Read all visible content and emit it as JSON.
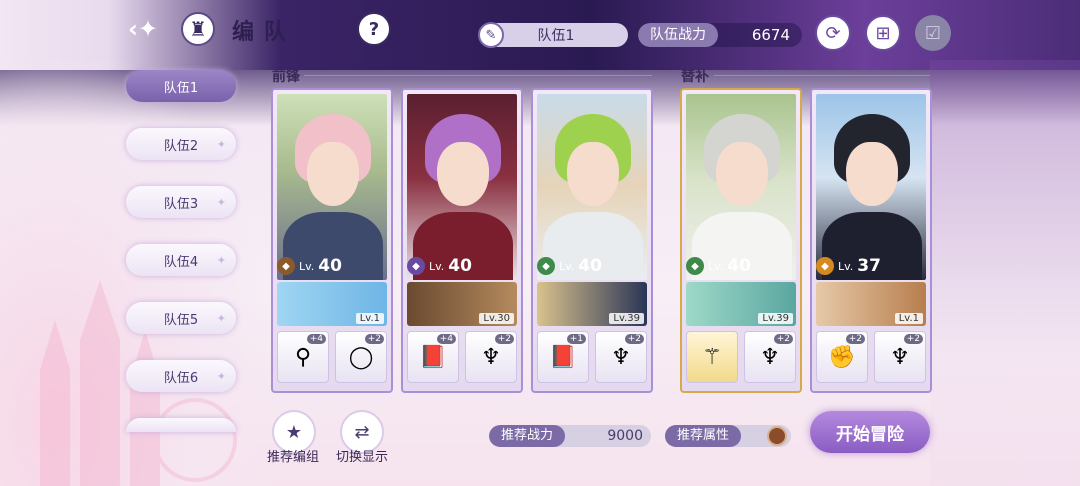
{
  "header": {
    "title": "编队",
    "current_team": "队伍1",
    "power_label": "队伍战力",
    "power_value": "6674"
  },
  "sidebar": {
    "teams": [
      "队伍1",
      "队伍2",
      "队伍3",
      "队伍4",
      "队伍5",
      "队伍6"
    ]
  },
  "sections": {
    "front": "前锋",
    "sub": "替补"
  },
  "cards": [
    {
      "level": "40",
      "element": "earth",
      "sub_level": "Lv.1",
      "equip": [
        {
          "icon": "staff-icon",
          "plus": "+4"
        },
        {
          "icon": "ring-icon",
          "plus": "+2"
        }
      ]
    },
    {
      "level": "40",
      "element": "arcane",
      "sub_level": "Lv.30",
      "equip": [
        {
          "icon": "book-icon",
          "plus": "+4"
        },
        {
          "icon": "earring-icon",
          "plus": "+2"
        }
      ]
    },
    {
      "level": "40",
      "element": "nature",
      "sub_level": "Lv.39",
      "equip": [
        {
          "icon": "book-icon",
          "plus": "+1"
        },
        {
          "icon": "earring-icon",
          "plus": "+2"
        }
      ]
    },
    {
      "level": "40",
      "element": "nature",
      "sub_level": "Lv.39",
      "equip": [
        {
          "icon": "wand-icon",
          "plus": ""
        },
        {
          "icon": "earring-icon",
          "plus": "+2"
        }
      ]
    },
    {
      "level": "37",
      "element": "fire",
      "sub_level": "Lv.1",
      "equip": [
        {
          "icon": "gauntlet-icon",
          "plus": "+2"
        },
        {
          "icon": "earring-icon",
          "plus": "+2"
        }
      ]
    }
  ],
  "level_prefix": "Lv.",
  "bottom": {
    "recommend_team": "推荐编组",
    "switch_display": "切换显示",
    "rec_power_label": "推荐战力",
    "rec_power_value": "9000",
    "rec_attr_label": "推荐属性",
    "start": "开始冒险"
  },
  "colors": {
    "accent": "#8a5cc3",
    "front_border": "#a990d6",
    "sub_border": "#d6a94a"
  }
}
